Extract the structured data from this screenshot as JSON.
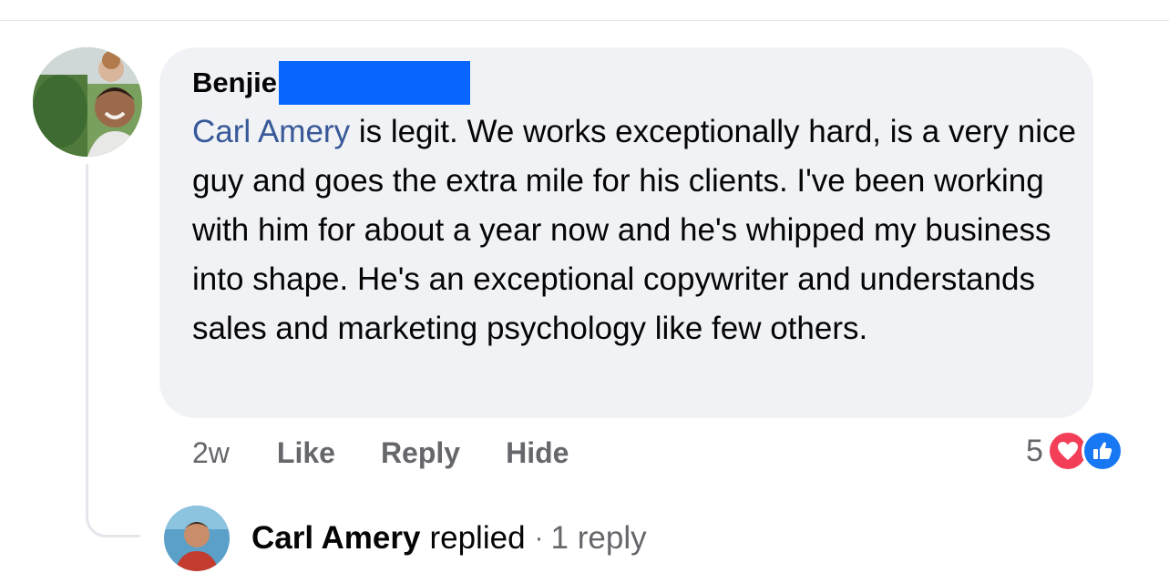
{
  "comment": {
    "author": "Benjie",
    "mention": "Carl Amery",
    "text": " is legit. We works exceptionally hard, is a very nice guy and goes the extra mile for his clients. I've been working with him for about a year now and he's whipped my business into shape. He's an exceptional copywriter and understands sales and marketing psychology like few others.",
    "timestamp": "2w",
    "actions": {
      "like": "Like",
      "reply": "Reply",
      "hide": "Hide"
    },
    "reaction_count": "5",
    "reaction_icons": [
      "heart-icon",
      "thumbs-up-icon"
    ]
  },
  "reply_summary": {
    "name": "Carl Amery",
    "verb": "replied",
    "separator": "·",
    "count_label": "1 reply"
  },
  "colors": {
    "bubble": "#f0f2f5",
    "mention": "#385898",
    "love": "#f33e58",
    "like": "#1877f2",
    "redaction": "#0866ff",
    "muted": "#65676b"
  }
}
